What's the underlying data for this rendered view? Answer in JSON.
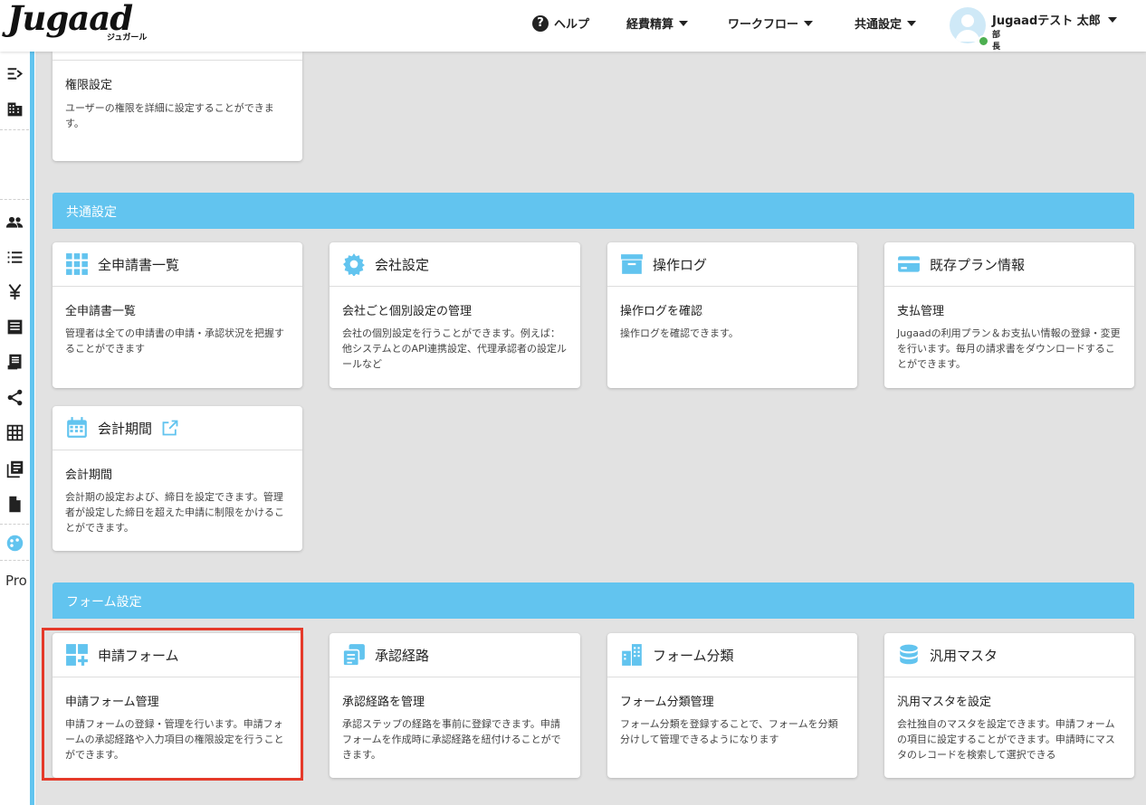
{
  "header": {
    "logo": "Jugaad",
    "logo_sub": "ジュガール",
    "nav": {
      "help": "ヘルプ",
      "expense": "経費精算",
      "workflow": "ワークフロー",
      "common_settings": "共通設定"
    },
    "user": {
      "name": "Jugaadテスト 太郎",
      "role": "部長"
    }
  },
  "sidebar": {
    "icons": [
      "menu-collapse-icon",
      "building-icon",
      "users-icon",
      "list-icon",
      "yen-icon",
      "ledger-icon",
      "receipt-icon",
      "share-icon",
      "grid-icon",
      "library-icon",
      "document-icon",
      "palette-icon"
    ],
    "truncated_label": "Pro"
  },
  "partial_card": {
    "subtitle": "権限設定",
    "desc": "ユーザーの権限を詳細に設定することができます。"
  },
  "sections": [
    {
      "title": "共通設定",
      "cards": [
        {
          "icon": "apps-grid-icon",
          "title": "全申請書一覧",
          "subtitle": "全申請書一覧",
          "desc": "管理者は全ての申請書の申請・承認状況を把握することができます"
        },
        {
          "icon": "gear-icon",
          "title": "会社設定",
          "subtitle": "会社ごと個別設定の管理",
          "desc": "会社の個別設定を行うことができます。例えば：他システムとのAPI連携設定、代理承認者の設定ルールなど"
        },
        {
          "icon": "archive-icon",
          "title": "操作ログ",
          "subtitle": "操作ログを確認",
          "desc": "操作ログを確認できます。"
        },
        {
          "icon": "credit-card-icon",
          "title": "既存プラン情報",
          "subtitle": "支払管理",
          "desc": "Jugaadの利用プラン＆お支払い情報の登録・変更を行います。毎月の請求書をダウンロードすることができます。"
        },
        {
          "icon": "calendar-icon",
          "title": "会計期間",
          "subtitle": "会計期間",
          "desc": "会計期の設定および、締日を設定できます。管理者が設定した締日を超えた申請に制限をかけることができます。",
          "external_link_icon": "external-link-icon"
        }
      ]
    },
    {
      "title": "フォーム設定",
      "cards": [
        {
          "icon": "form-add-icon",
          "title": "申請フォーム",
          "subtitle": "申請フォーム管理",
          "desc": "申請フォームの登録・管理を行います。申請フォームの承認経路や入力項目の権限設定を行うことができます。"
        },
        {
          "icon": "route-icon",
          "title": "承認経路",
          "subtitle": "承認経路を管理",
          "desc": "承認ステップの経路を事前に登録できます。申請フォームを作成時に承認経路を紐付けることができます。"
        },
        {
          "icon": "category-icon",
          "title": "フォーム分類",
          "subtitle": "フォーム分類管理",
          "desc": "フォーム分類を登録することで、フォームを分類分けして管理できるようになります"
        },
        {
          "icon": "database-icon",
          "title": "汎用マスタ",
          "subtitle": "汎用マスタを設定",
          "desc": "会社独自のマスタを設定できます。申請フォームの項目に設定することができます。申請時にマスタのレコードを検索して選択できる"
        }
      ]
    }
  ],
  "colors": {
    "accent": "#62c4ef",
    "highlight": "#e53a2a",
    "background": "#e2e2e2"
  }
}
